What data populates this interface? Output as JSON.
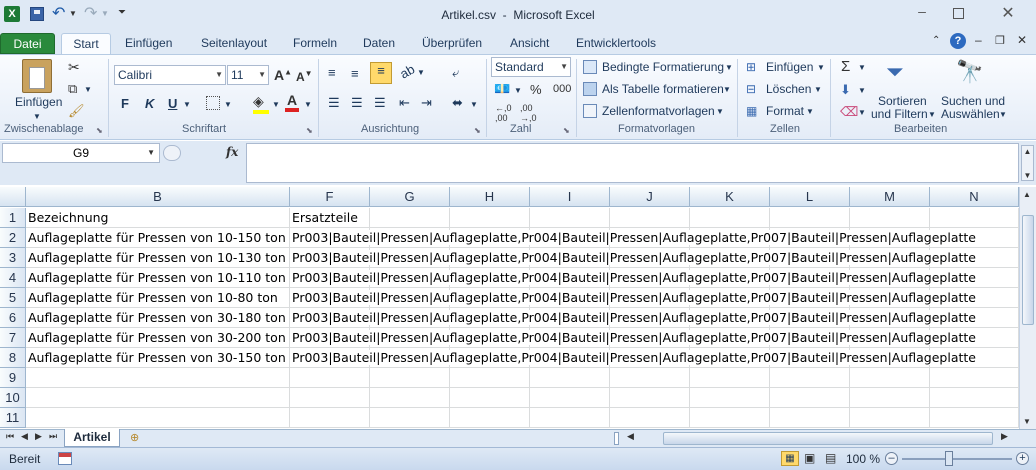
{
  "window": {
    "title": "Artikel.csv  -  Microsoft Excel"
  },
  "ribbon_tabs": [
    "Datei",
    "Start",
    "Einfügen",
    "Seitenlayout",
    "Formeln",
    "Daten",
    "Überprüfen",
    "Ansicht",
    "Entwicklertools"
  ],
  "ribbon": {
    "clipboard": {
      "paste_label": "Einfügen",
      "group": "Zwischenablage"
    },
    "font": {
      "name": "Calibri",
      "size": "11",
      "bold": "F",
      "italic": "K",
      "underline": "U",
      "group": "Schriftart"
    },
    "alignment": {
      "group": "Ausrichtung"
    },
    "number": {
      "format": "Standard",
      "group": "Zahl"
    },
    "styles": {
      "conditional": "Bedingte Formatierung",
      "as_table": "Als Tabelle formatieren",
      "cell_styles": "Zellenformatvorlagen",
      "group": "Formatvorlagen"
    },
    "cells": {
      "insert": "Einfügen",
      "delete": "Löschen",
      "format": "Format",
      "group": "Zellen"
    },
    "editing": {
      "sort_line1": "Sortieren",
      "sort_line2": "und Filtern",
      "find_line1": "Suchen und",
      "find_line2": "Auswählen",
      "group": "Bearbeiten"
    }
  },
  "formula_bar": {
    "name_box": "G9",
    "fx": "fx"
  },
  "grid": {
    "columns": [
      "B",
      "F",
      "G",
      "H",
      "I",
      "J",
      "K",
      "L",
      "M",
      "N"
    ],
    "rows": [
      "1",
      "2",
      "3",
      "4",
      "5",
      "6",
      "7",
      "8",
      "9",
      "10",
      "11"
    ],
    "header_row": {
      "B": "Bezeichnung",
      "F": "Ersatzteile"
    },
    "data": [
      {
        "B": "Auflageplatte für Pressen von 10-150 ton",
        "F": "Pr003|Bauteil|Pressen|Auflageplatte,Pr004|Bauteil|Pressen|Auflageplatte,Pr007|Bauteil|Pressen|Auflageplatte"
      },
      {
        "B": "Auflageplatte für Pressen von 10-130 ton",
        "F": "Pr003|Bauteil|Pressen|Auflageplatte,Pr004|Bauteil|Pressen|Auflageplatte,Pr007|Bauteil|Pressen|Auflageplatte"
      },
      {
        "B": "Auflageplatte für Pressen von 10-110 ton",
        "F": "Pr003|Bauteil|Pressen|Auflageplatte,Pr004|Bauteil|Pressen|Auflageplatte,Pr007|Bauteil|Pressen|Auflageplatte"
      },
      {
        "B": "Auflageplatte für Pressen von 10-80 ton",
        "F": "Pr003|Bauteil|Pressen|Auflageplatte,Pr004|Bauteil|Pressen|Auflageplatte,Pr007|Bauteil|Pressen|Auflageplatte"
      },
      {
        "B": "Auflageplatte für Pressen von 30-180 ton",
        "F": "Pr003|Bauteil|Pressen|Auflageplatte,Pr004|Bauteil|Pressen|Auflageplatte,Pr007|Bauteil|Pressen|Auflageplatte"
      },
      {
        "B": "Auflageplatte für Pressen von 30-200 ton",
        "F": "Pr003|Bauteil|Pressen|Auflageplatte,Pr004|Bauteil|Pressen|Auflageplatte,Pr007|Bauteil|Pressen|Auflageplatte"
      },
      {
        "B": "Auflageplatte für Pressen von 30-150 ton",
        "F": "Pr003|Bauteil|Pressen|Auflageplatte,Pr004|Bauteil|Pressen|Auflageplatte,Pr007|Bauteil|Pressen|Auflageplatte"
      }
    ]
  },
  "sheets": {
    "active": "Artikel"
  },
  "status": {
    "mode": "Bereit",
    "zoom": "100 %"
  },
  "colors": {
    "file_tab": "#2a8a3c",
    "ribbon_bg": "#dfe9f5",
    "highlight_yellow": "#ffd96b",
    "font_red": "#d22",
    "fill_yellow": "#ffff00"
  }
}
